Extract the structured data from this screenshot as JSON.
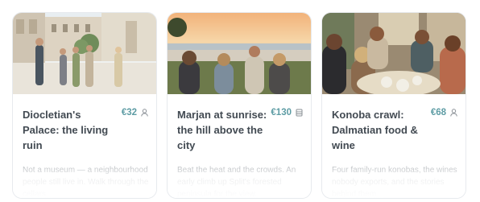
{
  "tours": [
    {
      "title": "Diocletian's Palace: the living ruin",
      "price": "€32",
      "group_icon": "person-icon",
      "description": "Not a museum — a neighbourhood people still live in. Walk through the cellars..."
    },
    {
      "title": "Marjan at sunrise: the hill above the city",
      "price": "€130",
      "group_icon": "group-icon",
      "description": "Beat the heat and the crowds. An early climb up Split's forested peninsula for the view..."
    },
    {
      "title": "Konoba crawl: Dalmatian food & wine",
      "price": "€68",
      "group_icon": "person-icon",
      "description": "Four family-run konobas, the wines nobody exports, and the stories behind them..."
    }
  ],
  "colors": {
    "price": "#5d9ca4",
    "title": "#424a52",
    "description": "#8a9096",
    "border": "#e7eaee"
  }
}
